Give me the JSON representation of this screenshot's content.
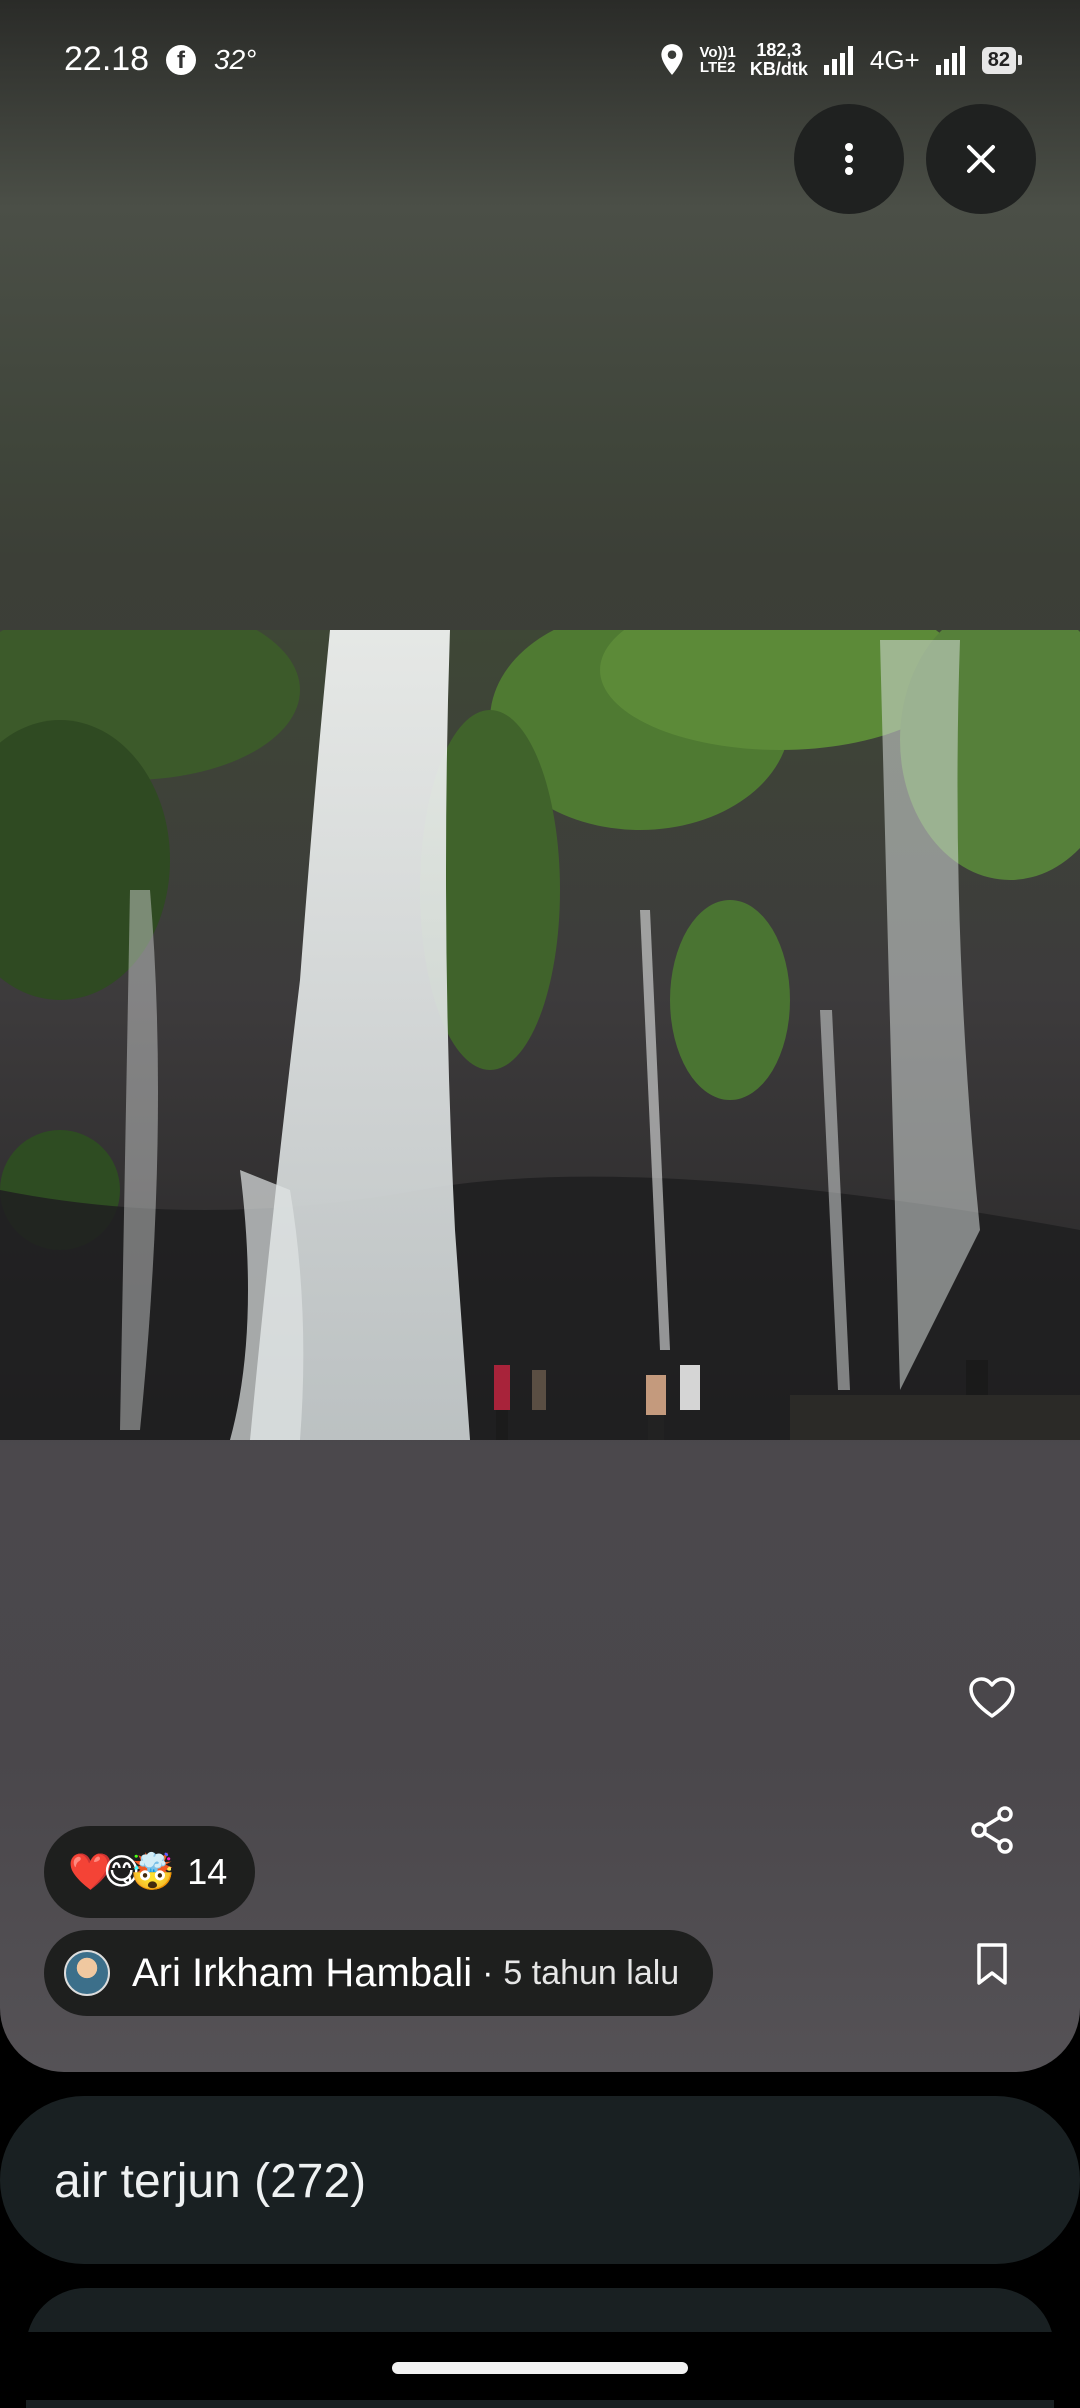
{
  "status_bar": {
    "time": "22.18",
    "temperature": "32°",
    "volte_top": "Vo))1",
    "volte_bottom": "LTE2",
    "speed_value": "182,3",
    "speed_unit": "KB/dtk",
    "network": "4G+",
    "battery": "82"
  },
  "toolbar": {
    "more_icon": "more-vert-icon",
    "close_icon": "close-icon"
  },
  "photo": {
    "icon": "waterfall-photo"
  },
  "actions": {
    "like_icon": "heart-outline-icon",
    "share_icon": "share-icon",
    "save_icon": "bookmark-icon"
  },
  "reactions": {
    "emojis": "❤️😋🤯",
    "count": "14"
  },
  "author": {
    "name": "Ari Irkham Hambali",
    "separator": "·",
    "time_ago": "5 tahun lalu"
  },
  "category": {
    "label": "air terjun (272)"
  },
  "colors": {
    "card_bg": "#192022",
    "pill_bg": "#1e1f1e",
    "button_bg": "#1f2120"
  }
}
